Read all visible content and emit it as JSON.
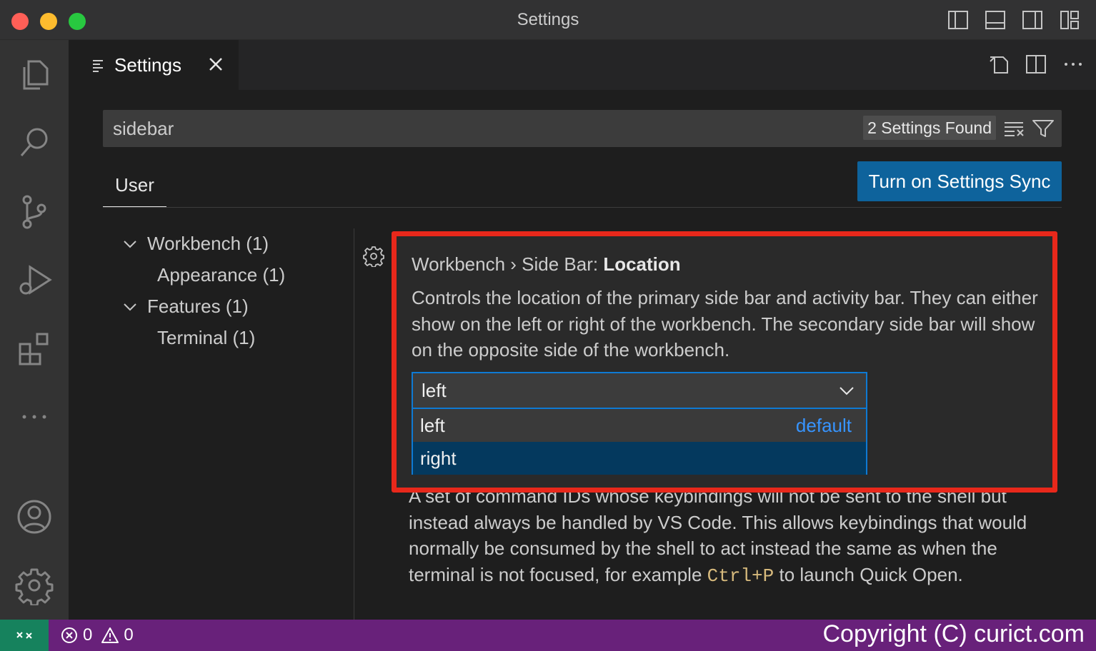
{
  "window": {
    "title": "Settings"
  },
  "tab": {
    "label": "Settings"
  },
  "search": {
    "value": "sidebar",
    "found": "2 Settings Found"
  },
  "scope_tab": "User",
  "sync_button": "Turn on Settings Sync",
  "toc": {
    "items": [
      {
        "label": "Workbench (1)",
        "expanded": true
      },
      {
        "label": "Appearance (1)"
      },
      {
        "label": "Features (1)",
        "expanded": true
      },
      {
        "label": "Terminal (1)"
      }
    ]
  },
  "setting": {
    "category": "Workbench › Side Bar: ",
    "name": "Location",
    "description": "Controls the location of the primary side bar and activity bar. They can either show on the left or right of the workbench. The secondary side bar will show on the opposite side of the workbench.",
    "selected": "left",
    "options": [
      {
        "label": "left",
        "tag": "default"
      },
      {
        "label": "right"
      }
    ]
  },
  "setting2": {
    "desc_before": "A set of command IDs whose keybindings will not be sent to the shell but instead always be handled by VS Code. This allows keybindings that would normally be consumed by the shell to act instead the same as when the terminal is not focused, for example ",
    "shortcut": "Ctrl+P",
    "desc_after": " to launch Quick Open."
  },
  "status": {
    "errors": "0",
    "warnings": "0",
    "copyright": "Copyright (C) curict.com"
  },
  "colors": {
    "accent": "#0e639c",
    "focus_border": "#0e7ad3",
    "highlight": "#e8281b",
    "status_bar": "#68217a",
    "remote": "#16825d"
  }
}
